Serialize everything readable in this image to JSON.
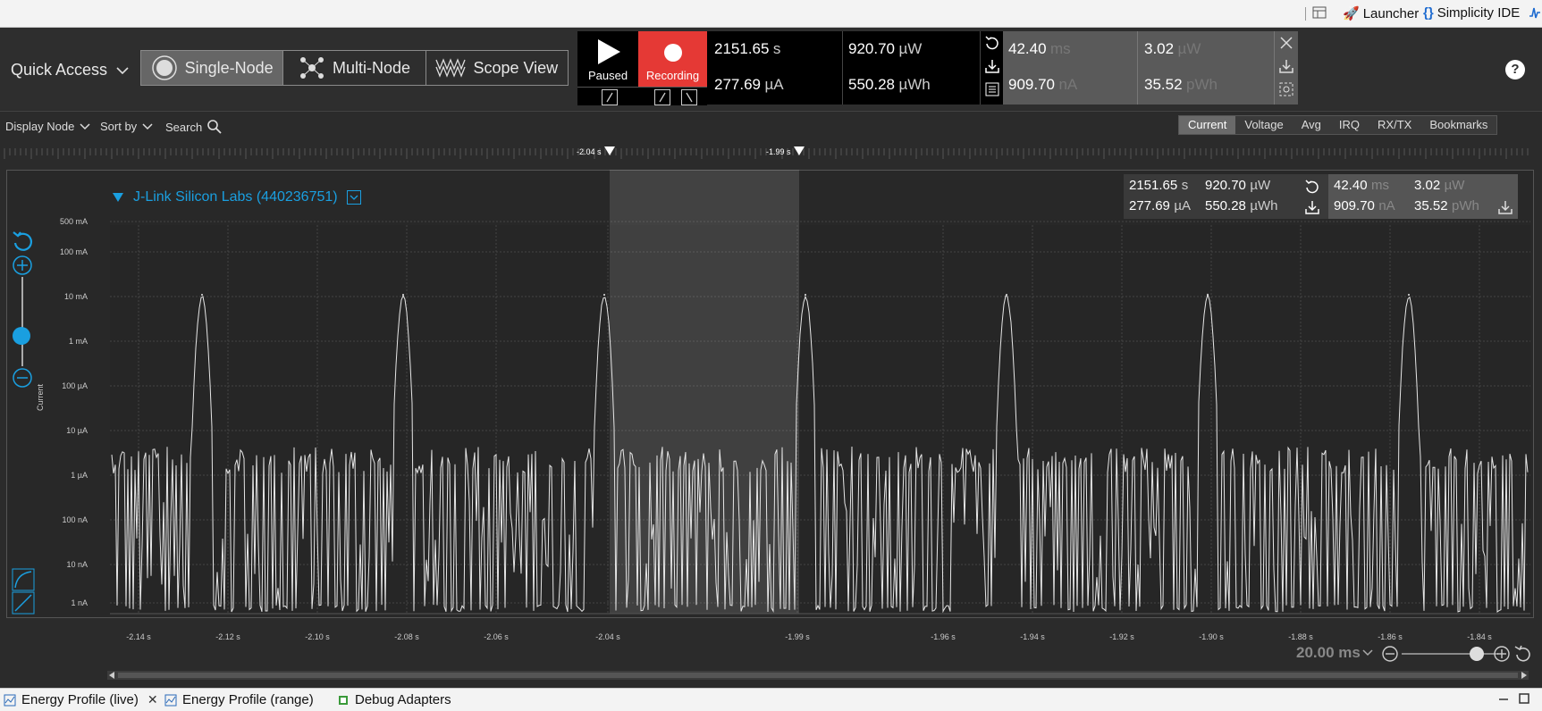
{
  "topbar": {
    "launcher_label": "Launcher",
    "ide_label": "Simplicity IDE"
  },
  "header": {
    "quick_access_label": "Quick Access",
    "modes": [
      {
        "label": "Single-Node",
        "active": true
      },
      {
        "label": "Multi-Node",
        "active": false
      },
      {
        "label": "Scope View",
        "active": false
      }
    ],
    "paused_label": "Paused",
    "recording_label": "Recording",
    "stats_left": {
      "time_value": "2151.65",
      "time_unit": "s",
      "current_value": "277.69",
      "current_unit": "µA",
      "power_value": "920.70",
      "power_unit": "µW",
      "energy_value": "550.28",
      "energy_unit": "µWh"
    },
    "stats_right": {
      "time_value": "42.40",
      "time_unit": "ms",
      "current_value": "909.70",
      "current_unit": "nA",
      "power_value": "3.02",
      "power_unit": "µW",
      "energy_value": "35.52",
      "energy_unit": "pWh"
    },
    "help_label": "?"
  },
  "toolbar": {
    "display_node_label": "Display Node",
    "sort_by_label": "Sort by",
    "search_label": "Search",
    "tabs": [
      {
        "label": "Current",
        "active": true
      },
      {
        "label": "Voltage",
        "active": false
      },
      {
        "label": "Avg",
        "active": false
      },
      {
        "label": "IRQ",
        "active": false
      },
      {
        "label": "RX/TX",
        "active": false
      },
      {
        "label": "Bookmarks",
        "active": false
      }
    ]
  },
  "markers": {
    "left_label": "-2.04 s",
    "right_label": "-1.99 s"
  },
  "device": {
    "name": "J-Link Silicon Labs (440236751)"
  },
  "chart_stats": {
    "left": {
      "time_value": "2151.65",
      "time_unit": "s",
      "current_value": "277.69",
      "current_unit": "µA",
      "power_value": "920.70",
      "power_unit": "µW",
      "energy_value": "550.28",
      "energy_unit": "µWh"
    },
    "right": {
      "time_value": "42.40",
      "time_unit": "ms",
      "current_value": "909.70",
      "current_unit": "nA",
      "power_value": "3.02",
      "power_unit": "µW",
      "energy_value": "35.52",
      "energy_unit": "pWh"
    }
  },
  "chart_data": {
    "type": "line",
    "ylabel": "Current",
    "yscale": "log",
    "ytick_labels": [
      "500 mA",
      "100 mA",
      "10 mA",
      "1 mA",
      "100 µA",
      "10 µA",
      "1 µA",
      "100 nA",
      "10 nA",
      "1 nA"
    ],
    "xtick_labels": [
      "-2.14 s",
      "-2.12 s",
      "-2.10 s",
      "-2.08 s",
      "-2.06 s",
      "-2.04 s",
      "-1.99 s",
      "-1.96 s",
      "-1.94 s",
      "-1.92 s",
      "-1.90 s",
      "-1.88 s",
      "-1.86 s",
      "-1.84 s"
    ],
    "series": [
      {
        "values_desc": "",
        "peaks_s": [
          -2.125,
          -2.08,
          -2.035,
          -1.99,
          -1.945,
          -1.9,
          -1.855
        ],
        "peak_current_mA": 12,
        "baseline_range": [
          "1 nA",
          "10 µA"
        ]
      }
    ],
    "selection_range_s": [
      -2.04,
      -1.99
    ],
    "color": "#e6e6e6"
  },
  "zoom": {
    "value": "20.00 ms",
    "level": 0.78
  },
  "bottom_tabs": [
    {
      "label": "Energy Profile (live)",
      "active": true
    },
    {
      "label": "Energy Profile (range)",
      "active": false
    },
    {
      "label": "Debug Adapters",
      "active": false
    }
  ],
  "colors": {
    "accent": "#1a9fe0",
    "recording": "#e53935",
    "trace": "#e6e6e6"
  }
}
